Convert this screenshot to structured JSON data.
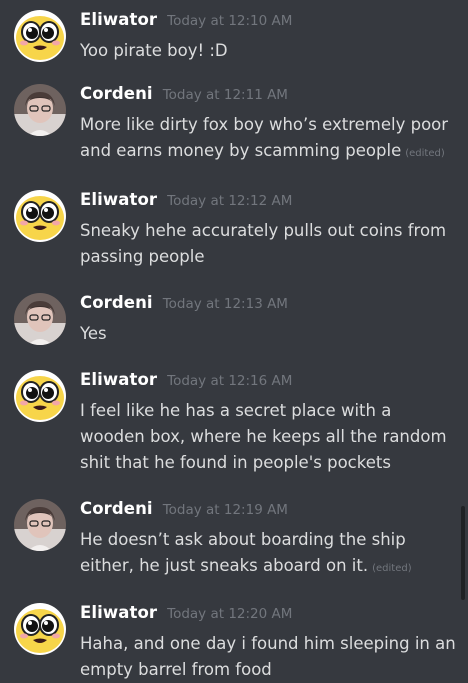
{
  "colors": {
    "background": "#36393f",
    "author": "#ffffff",
    "timestamp": "#72767d",
    "text": "#dcddde"
  },
  "edited_label": "(edited)",
  "messages": [
    {
      "author": "Eliwator",
      "timestamp": "Today at 12:10 AM",
      "avatar_icon": "cartoon-face-avatar-icon",
      "lines": [
        "Yoo pirate boy! :D"
      ],
      "edited": false
    },
    {
      "author": "Cordeni",
      "timestamp": "Today at 12:11 AM",
      "avatar_icon": "user-photo-avatar-icon",
      "lines": [
        "More like dirty fox boy who’s extremely poor",
        "and earns money by scamming people"
      ],
      "edited": true
    },
    {
      "author": "Eliwator",
      "timestamp": "Today at 12:12 AM",
      "avatar_icon": "cartoon-face-avatar-icon",
      "lines": [
        "Sneaky hehe accurately pulls out coins from",
        "passing people"
      ],
      "edited": false
    },
    {
      "author": "Cordeni",
      "timestamp": "Today at 12:13 AM",
      "avatar_icon": "user-photo-avatar-icon",
      "lines": [
        "Yes"
      ],
      "edited": false
    },
    {
      "author": "Eliwator",
      "timestamp": "Today at 12:16 AM",
      "avatar_icon": "cartoon-face-avatar-icon",
      "lines": [
        "I feel like he has a secret place with a",
        "wooden box, where he keeps all the random",
        "shit that he found in people's pockets"
      ],
      "edited": false
    },
    {
      "author": "Cordeni",
      "timestamp": "Today at 12:19 AM",
      "avatar_icon": "user-photo-avatar-icon",
      "lines": [
        "He doesn’t ask about boarding the ship",
        "either, he just sneaks aboard on it."
      ],
      "edited": true
    },
    {
      "author": "Eliwator",
      "timestamp": "Today at 12:20 AM",
      "avatar_icon": "cartoon-face-avatar-icon",
      "lines": [
        "Haha, and one day i found him sleeping in an",
        "empty barrel from food"
      ],
      "edited": false
    }
  ]
}
